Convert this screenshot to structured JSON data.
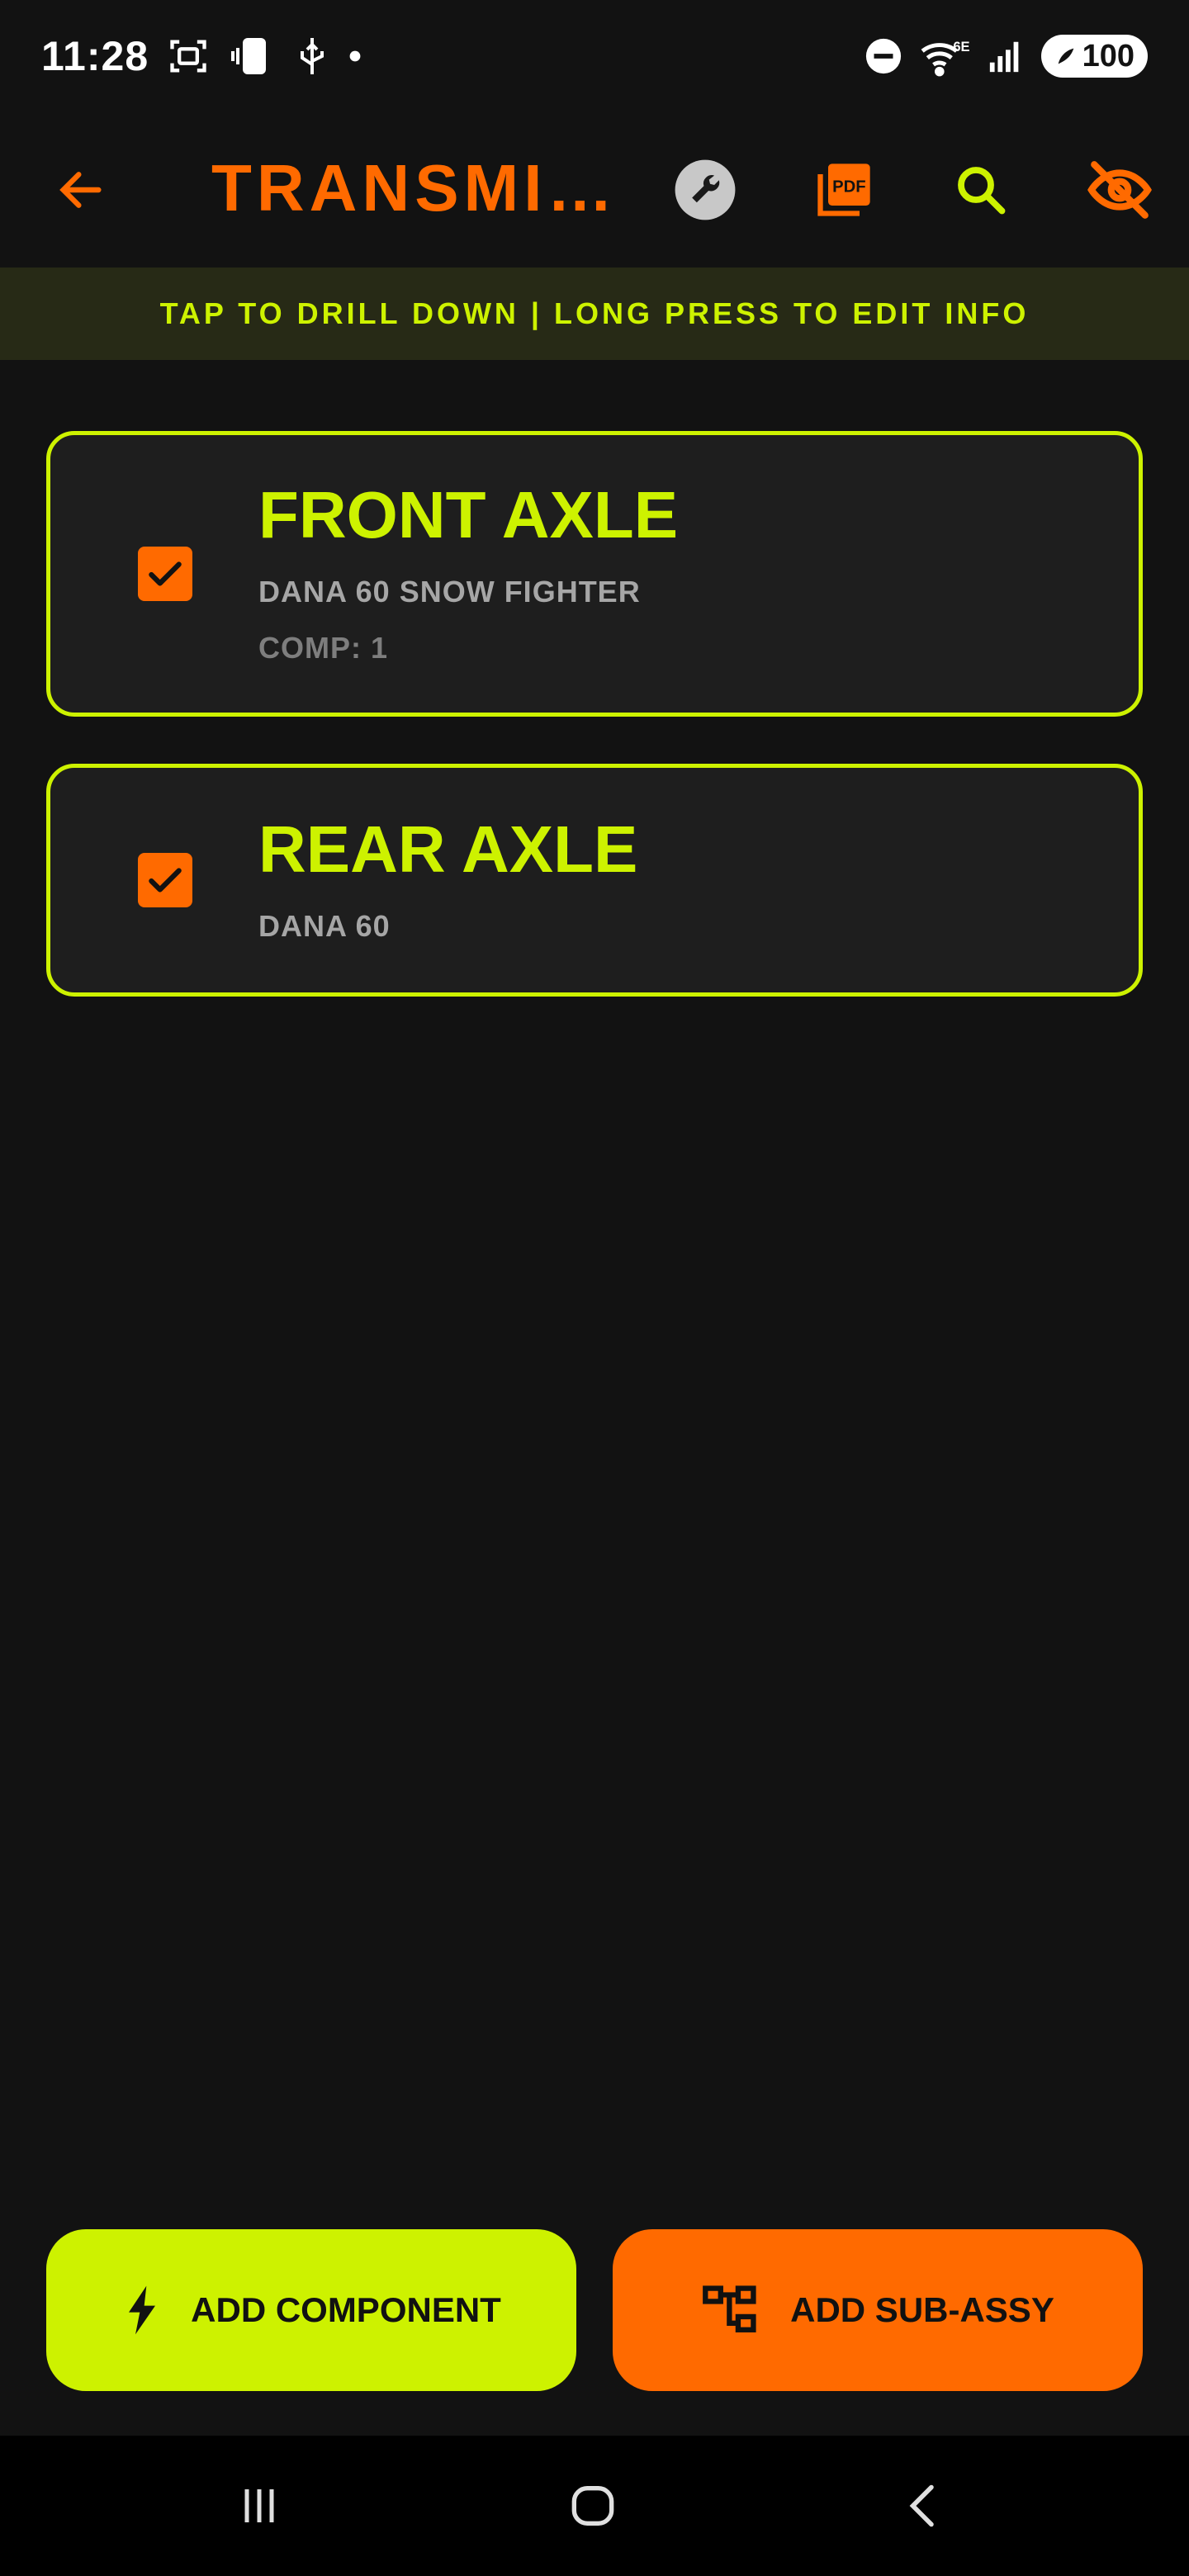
{
  "status_bar": {
    "time": "11:28",
    "battery": "100"
  },
  "app_bar": {
    "title": "TRANSMI…"
  },
  "hint": "TAP TO DRILL DOWN | LONG PRESS TO EDIT INFO",
  "items": [
    {
      "title": "FRONT AXLE",
      "subtitle": "DANA 60 SNOW FIGHTER",
      "comp": "COMP: 1",
      "checked": true
    },
    {
      "title": "REAR AXLE",
      "subtitle": "DANA 60",
      "checked": true
    }
  ],
  "actions": {
    "add_component": "ADD COMPONENT",
    "add_subassy": "ADD SUB-ASSY"
  },
  "icons": {
    "back": "arrow-left-icon",
    "tools": "wrench-icon",
    "pdf": "pdf-icon",
    "search": "search-icon",
    "visibility": "eye-off-icon",
    "component": "bolt-icon",
    "subassy": "hierarchy-icon"
  },
  "colors": {
    "accent_lime": "#cdf200",
    "accent_orange": "#ff6a00",
    "background": "#121212",
    "card": "#1e1e1e"
  }
}
